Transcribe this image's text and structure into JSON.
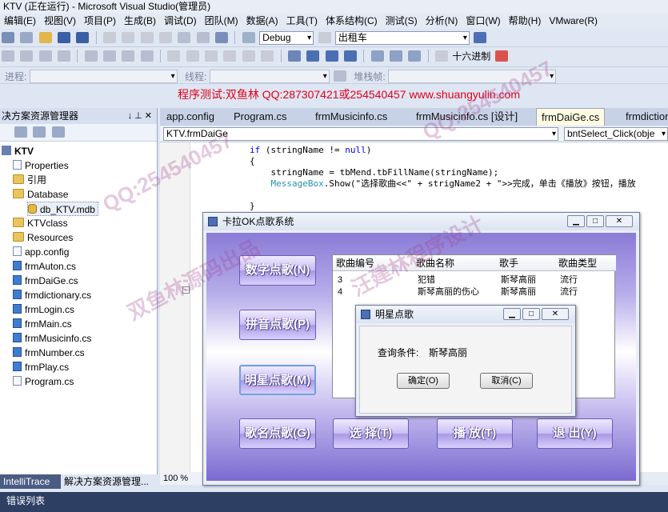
{
  "window": {
    "title": "KTV (正在运行) - Microsoft Visual Studio(管理员)"
  },
  "menu": [
    "编辑(E)",
    "视图(V)",
    "项目(P)",
    "生成(B)",
    "调试(D)",
    "团队(M)",
    "数据(A)",
    "工具(T)",
    "体系结构(C)",
    "测试(S)",
    "分析(N)",
    "窗口(W)",
    "帮助(H)",
    "VMware(R)"
  ],
  "toolbar": {
    "config_combo": "Debug",
    "platform_combo": "出租车",
    "hex_label": "十六进制",
    "process_label": "进程:",
    "thread_label": "线程:",
    "stackframe_label": "堆栈帧:"
  },
  "promo": "程序测试:双鱼林 QQ:287307421或254540457 www.shuangyulin.com",
  "solution_explorer": {
    "title": "决方案资源管理器",
    "pin": "↓ ⊥ ✕",
    "items": [
      "KTV",
      "Properties",
      "引用",
      "Database",
      "db_KTV.mdb",
      "KTVclass",
      "Resources",
      "app.config",
      "frmAuton.cs",
      "frmDaiGe.cs",
      "frmdictionary.cs",
      "frmLogin.cs",
      "frmMain.cs",
      "frmMusicinfo.cs",
      "frmNumber.cs",
      "frmPlay.cs",
      "Program.cs"
    ]
  },
  "editor": {
    "tabs": [
      "app.config",
      "Program.cs",
      "frmMusicinfo.cs",
      "frmMusicinfo.cs [设计]",
      "frmDaiGe.cs",
      "frmdiction"
    ],
    "class_combo": "KTV.frmDaiGe",
    "method_combo": "bntSelect_Click(obje",
    "code": [
      "if (stringName != null)",
      "{",
      "    stringName = tbMend.tbFillName(stringName);",
      "    MessageBox.Show(\"选择歌曲<<\" + strigName2 + \">>完成，单击《播放》按钮，播放"
    ],
    "zoom": "100 %"
  },
  "ktv_window": {
    "title": "卡拉OK点歌系统",
    "buttons": [
      "数字点歌(N)",
      "拼音点歌(P)",
      "明星点歌(M)",
      "歌名点歌(G)",
      "选 择(T)",
      "播 放(T)",
      "退 出(Y)"
    ],
    "grid": {
      "headers": [
        "歌曲编号",
        "歌曲名称",
        "歌手",
        "歌曲类型"
      ],
      "rows": [
        [
          "3",
          "犯错",
          "斯琴高丽",
          "流行"
        ],
        [
          "4",
          "斯琴高丽的伤心",
          "斯琴高丽",
          "流行"
        ]
      ]
    }
  },
  "dialog": {
    "title": "明星点歌",
    "label": "查询条件:",
    "value": "斯琴高丽",
    "ok": "确定(O)",
    "cancel": "取消(C)"
  },
  "bottom": {
    "tabs": [
      "IntelliTrace",
      "解决方案资源管理..."
    ],
    "error_list": "错误列表"
  },
  "watermarks": [
    "QQ:254540457",
    "双鱼林源码出品",
    "汪建林程序设计"
  ]
}
